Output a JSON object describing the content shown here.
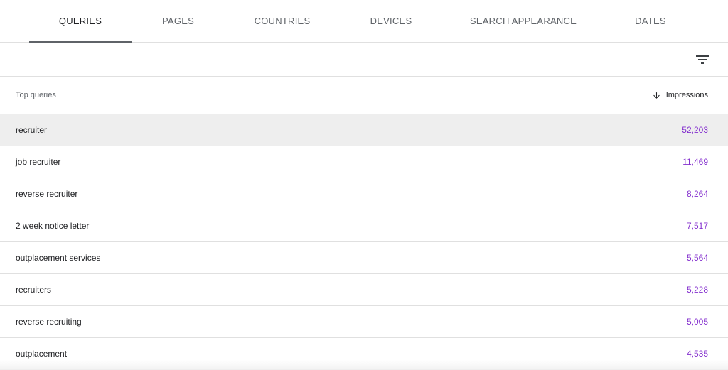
{
  "tabs": [
    {
      "label": "QUERIES",
      "active": true
    },
    {
      "label": "PAGES",
      "active": false
    },
    {
      "label": "COUNTRIES",
      "active": false
    },
    {
      "label": "DEVICES",
      "active": false
    },
    {
      "label": "SEARCH APPEARANCE",
      "active": false
    },
    {
      "label": "DATES",
      "active": false
    }
  ],
  "filter": {
    "icon": "filter-icon"
  },
  "table": {
    "headers": {
      "query": "Top queries",
      "impressions": "Impressions",
      "sort_icon": "arrow-down-icon"
    },
    "rows": [
      {
        "query": "recruiter",
        "impressions": "52,203",
        "highlighted": true
      },
      {
        "query": "job recruiter",
        "impressions": "11,469"
      },
      {
        "query": "reverse recruiter",
        "impressions": "8,264"
      },
      {
        "query": "2 week notice letter",
        "impressions": "7,517"
      },
      {
        "query": "outplacement services",
        "impressions": "5,564"
      },
      {
        "query": "recruiters",
        "impressions": "5,228"
      },
      {
        "query": "reverse recruiting",
        "impressions": "5,005"
      },
      {
        "query": "outplacement",
        "impressions": "4,535"
      }
    ]
  },
  "colors": {
    "impressions_value": "#8430ce",
    "tab_underline": "#5f6368",
    "highlight_row": "#eeeeee"
  }
}
